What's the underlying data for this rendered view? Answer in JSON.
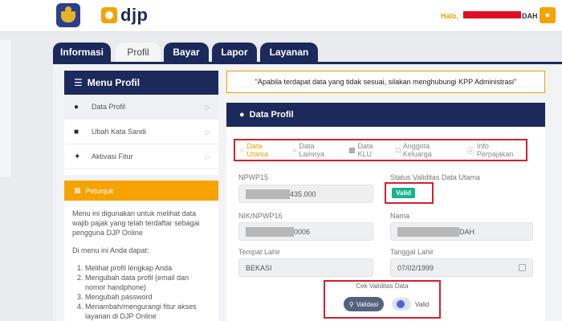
{
  "header": {
    "brand": "djp",
    "greeting": "Halo,",
    "user_suffix": "DAH"
  },
  "nav_tabs": [
    {
      "label": "Informasi"
    },
    {
      "label": "Profil"
    },
    {
      "label": "Bayar"
    },
    {
      "label": "Lapor"
    },
    {
      "label": "Layanan"
    }
  ],
  "menu": {
    "title": "Menu Profil",
    "items": [
      {
        "label": "Data Profil",
        "icon": "user-icon"
      },
      {
        "label": "Ubah Kata Sandi",
        "icon": "lock-icon"
      },
      {
        "label": "Aktivasi Fitur",
        "icon": "pin-icon"
      }
    ]
  },
  "petunjuk": {
    "title": "Petunjuk",
    "intro": "Menu ini digunakan untuk melihat data wajib pajak yang telah terdaftar sebagai pengguna DJP Online",
    "lead": "Di menu ini Anda dapat:",
    "steps": [
      "Melihat profil lengkap Anda",
      "Mengubah data profil (email dan nomor handphone)",
      "Mengubah password",
      "Menambah/mengurangi fitur akses layanan di DJP Online"
    ]
  },
  "notice": "\"Apabila terdapat data yang tidak sesuai, silakan menghubungi KPP Administrasi\"",
  "data_profil": {
    "title": "Data Profil",
    "subtabs": [
      {
        "label": "Data Utama",
        "icon": "user-icon"
      },
      {
        "label": "Data Lainnya",
        "icon": "users-icon"
      },
      {
        "label": "Data KLU",
        "icon": "briefcase-icon"
      },
      {
        "label": "Anggota Keluarga",
        "icon": "family-icon"
      },
      {
        "label": "Info Perpajakan",
        "icon": "info-icon"
      }
    ],
    "fields": {
      "npwp_label": "NPWP15",
      "npwp_value": "435.000",
      "status_label": "Status Validitas Data Utama",
      "status_value": "Valid",
      "nik_label": "NIK/NPWP16",
      "nik_value": "0006",
      "nama_label": "Nama",
      "nama_value": "DAH",
      "tempat_label": "Tempat Lahir",
      "tempat_value": "BEKASI",
      "tanggal_label": "Tanggal Lahir",
      "tanggal_value": "07/02/1999"
    },
    "cek": {
      "title": "Cek Validitas Data",
      "button": "Validasi",
      "toggle_label": "Valid"
    }
  },
  "colors": {
    "navy": "#1b2a5a",
    "accent": "#f5a300",
    "valid_green": "#18b38c",
    "highlight_red": "#d32030"
  }
}
